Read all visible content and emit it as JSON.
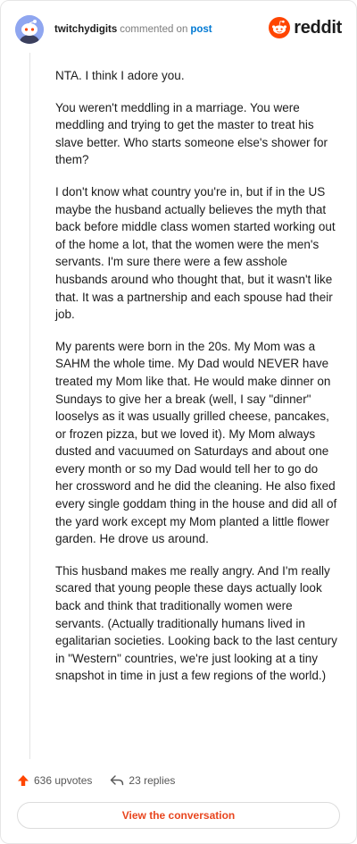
{
  "header": {
    "username": "twitchydigits",
    "action_text": "commented on",
    "post_link": "post",
    "brand": "reddit"
  },
  "comment": {
    "paragraphs": [
      "NTA. I think I adore you.",
      "You weren't meddling in a marriage. You were meddling and trying to get the master to treat his slave better. Who starts someone else's shower for them?",
      "I don't know what country you're in, but if in the US maybe the husband actually believes the myth that back before middle class women started working out of the home a lot, that the women were the men's servants. I'm sure there were a few asshole husbands around who thought that, but it wasn't like that. It was a partnership and each spouse had their job.",
      "My parents were born in the 20s. My Mom was a SAHM the whole time. My Dad would NEVER have treated my Mom like that. He would make dinner on Sundays to give her a break (well, I say \"dinner\" looselys as it was usually grilled cheese, pancakes, or frozen pizza, but we loved it). My Mom always dusted and vacuumed on Saturdays and about one every month or so my Dad would tell her to go do her crossword and he did the cleaning. He also fixed every single goddam thing in the house and did all of the yard work except my Mom planted a little flower garden. He drove us around.",
      "This husband makes me really angry. And I'm really scared that young people these days actually look back and think that traditionally women were servants. (Actually traditionally humans lived in egalitarian societies. Looking back to the last century in \"Western\" countries, we're just looking at a tiny snapshot in time in just a few regions of the world.)"
    ]
  },
  "footer": {
    "upvotes": "636 upvotes",
    "replies": "23 replies",
    "cta": "View the conversation"
  },
  "icons": {
    "avatar": "snoo-avatar-icon",
    "logo": "reddit-snoo-logo-icon",
    "upvote": "upvote-arrow-icon",
    "replies": "reply-arrow-icon"
  },
  "colors": {
    "brand_orange": "#ff4500",
    "link_blue": "#0079d3",
    "cta_orange": "#e8461f",
    "avatar_blue": "#8fa6f0"
  }
}
